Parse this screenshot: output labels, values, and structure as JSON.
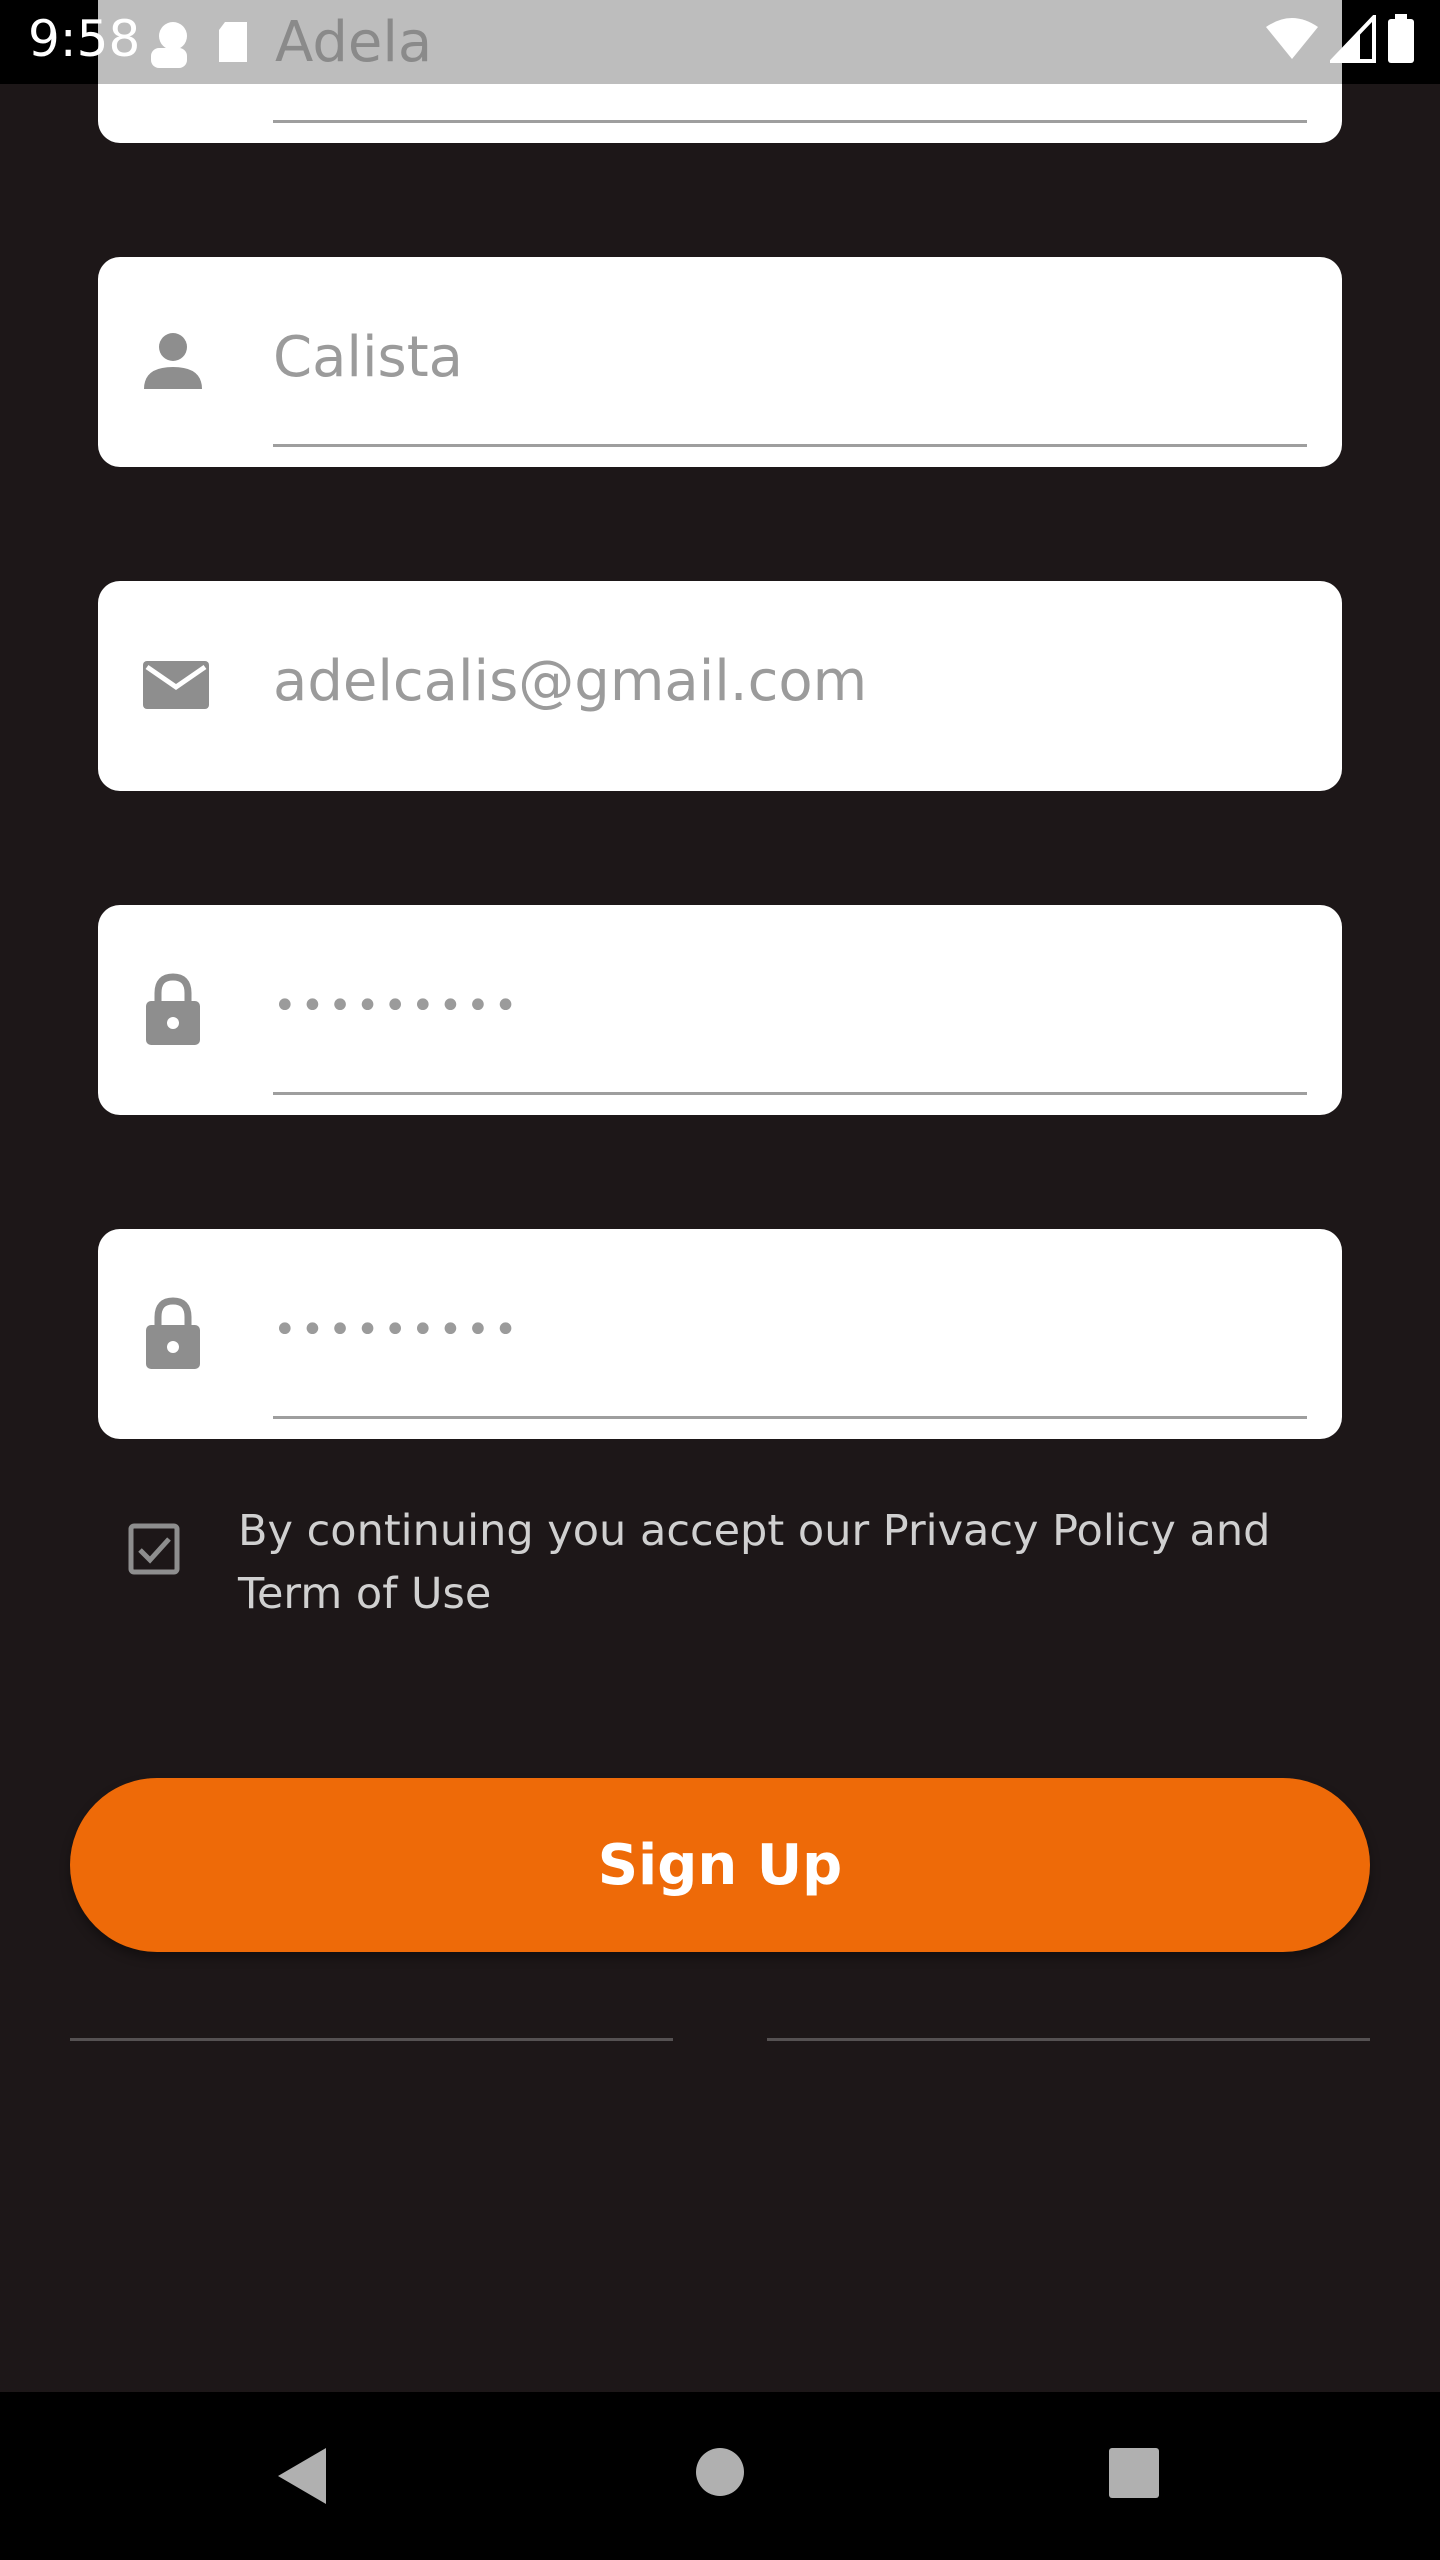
{
  "status_bar": {
    "time": "9:58",
    "icons": [
      "signal-icon",
      "wifi-icon",
      "battery-icon",
      "sim-icon",
      "notification-icon"
    ]
  },
  "form": {
    "top_field_value": "Adela",
    "last_name_value": "Calista",
    "email_value": "adelcalis@gmail.com",
    "password_value": "•••••••••",
    "confirm_password_value": "•••••••••",
    "terms_text": "By continuing you accept our Privacy Policy and Term of Use",
    "terms_checked": true,
    "signup_label": "Sign Up"
  },
  "colors": {
    "background": "#1d1718",
    "accent": "#ee6a08",
    "card": "#ffffff",
    "field_text": "#9b9b9b"
  },
  "nav_bar": {
    "buttons": [
      "back-icon",
      "home-icon",
      "recents-icon"
    ]
  }
}
